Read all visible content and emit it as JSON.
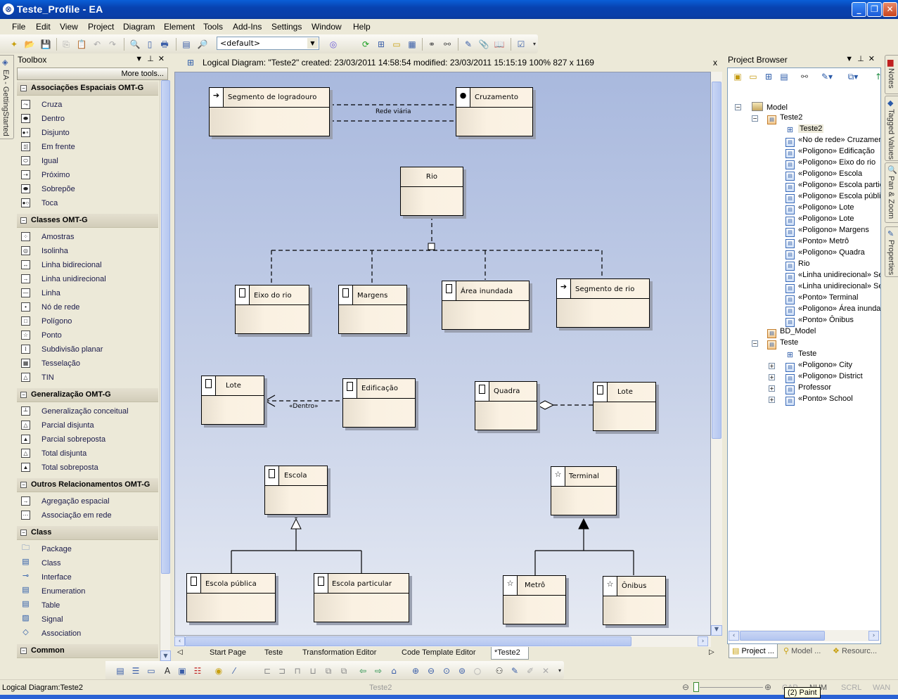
{
  "window": {
    "title": "Teste_Profile - EA"
  },
  "menu": [
    "File",
    "Edit",
    "View",
    "Project",
    "Diagram",
    "Element",
    "Tools",
    "Add-Ins",
    "Settings",
    "Window",
    "Help"
  ],
  "toolbar": {
    "perspective_value": "<default>"
  },
  "left_side_tab": "EA - GettingStarted",
  "toolbox": {
    "title": "Toolbox",
    "more_tools": "More tools...",
    "groups": [
      {
        "name": "Associações Espaciais OMT-G",
        "items": [
          {
            "label": "Cruza",
            "icon": "cross-relation-icon"
          },
          {
            "label": "Dentro",
            "icon": "inside-relation-icon"
          },
          {
            "label": "Disjunto",
            "icon": "disjoint-relation-icon"
          },
          {
            "label": "Em frente",
            "icon": "in-front-relation-icon"
          },
          {
            "label": "Igual",
            "icon": "equal-relation-icon"
          },
          {
            "label": "Próximo",
            "icon": "near-relation-icon"
          },
          {
            "label": "Sobrepõe",
            "icon": "overlap-relation-icon"
          },
          {
            "label": "Toca",
            "icon": "touch-relation-icon"
          }
        ]
      },
      {
        "name": "Classes OMT-G",
        "items": [
          {
            "label": "Amostras",
            "icon": "samples-icon"
          },
          {
            "label": "Isolinha",
            "icon": "isoline-icon"
          },
          {
            "label": "Linha bidirecional",
            "icon": "bidirectional-line-icon"
          },
          {
            "label": "Linha unidirecional",
            "icon": "unidirectional-line-icon"
          },
          {
            "label": "Linha",
            "icon": "line-icon"
          },
          {
            "label": "Nó de rede",
            "icon": "network-node-icon"
          },
          {
            "label": "Polígono",
            "icon": "polygon-icon"
          },
          {
            "label": "Ponto",
            "icon": "point-star-icon"
          },
          {
            "label": "Subdivisão planar",
            "icon": "planar-subdivision-icon"
          },
          {
            "label": "Tesselação",
            "icon": "tessellation-icon"
          },
          {
            "label": "TIN",
            "icon": "tin-icon"
          }
        ]
      },
      {
        "name": "Generalização OMT-G",
        "items": [
          {
            "label": "Generalização conceitual",
            "icon": "conceptual-generalization-icon"
          },
          {
            "label": "Parcial disjunta",
            "icon": "partial-disjoint-icon"
          },
          {
            "label": "Parcial sobreposta",
            "icon": "partial-overlapping-icon"
          },
          {
            "label": "Total disjunta",
            "icon": "total-disjoint-icon"
          },
          {
            "label": "Total sobreposta",
            "icon": "total-overlapping-icon"
          }
        ]
      },
      {
        "name": "Outros Relacionamentos OMT-G",
        "items": [
          {
            "label": "Agregação espacial",
            "icon": "spatial-aggregation-icon"
          },
          {
            "label": "Associação em rede",
            "icon": "network-association-icon"
          }
        ]
      },
      {
        "name": "Class",
        "items": [
          {
            "label": "Package",
            "icon": "package-icon"
          },
          {
            "label": "Class",
            "icon": "class-icon"
          },
          {
            "label": "Interface",
            "icon": "interface-icon"
          },
          {
            "label": "Enumeration",
            "icon": "enumeration-icon"
          },
          {
            "label": "Table",
            "icon": "table-icon"
          },
          {
            "label": "Signal",
            "icon": "signal-icon"
          },
          {
            "label": "Association",
            "icon": "association-icon"
          }
        ]
      },
      {
        "name": "Common",
        "items": []
      }
    ]
  },
  "diagram": {
    "header": "Logical Diagram: \"Teste2\"   created: 23/03/2011 14:58:54  modified: 23/03/2011 15:15:19   100%   827 x 1169",
    "classes": {
      "segmento_logradouro": "Segmento de logradouro",
      "cruzamento": "Cruzamento",
      "rio": "Rio",
      "eixo_rio": "Eixo do rio",
      "margens": "Margens",
      "area_inundada": "Área inundada",
      "segmento_rio": "Segmento de rio",
      "lote1": "Lote",
      "edificacao": "Edificação",
      "quadra": "Quadra",
      "lote2": "Lote",
      "escola": "Escola",
      "escola_publica": "Escola pública",
      "escola_particular": "Escola particular",
      "terminal": "Terminal",
      "metro": "Metrô",
      "onibus": "Ônibus"
    },
    "labels": {
      "rede_viaria": "Rede viária",
      "dentro": "«Dentro»"
    }
  },
  "doc_tabs": [
    "Start Page",
    "Teste",
    "Transformation Editor",
    "Code Template Editor",
    "*Teste2"
  ],
  "active_doc_tab": "*Teste2",
  "project_browser": {
    "title": "Project Browser",
    "tree": [
      {
        "label": "Model",
        "level": 0,
        "type": "model",
        "expander": "-"
      },
      {
        "label": "Teste2",
        "level": 1,
        "type": "package",
        "expander": "-"
      },
      {
        "label": "Teste2",
        "level": 2,
        "type": "diagram",
        "selected": true
      },
      {
        "label": "«No de rede» Cruzamento",
        "level": 2,
        "type": "class"
      },
      {
        "label": "«Poligono» Edificação",
        "level": 2,
        "type": "class"
      },
      {
        "label": "«Poligono» Eixo do rio",
        "level": 2,
        "type": "class"
      },
      {
        "label": "«Poligono» Escola",
        "level": 2,
        "type": "class"
      },
      {
        "label": "«Poligono» Escola particular",
        "level": 2,
        "type": "class"
      },
      {
        "label": "«Poligono» Escola pública",
        "level": 2,
        "type": "class"
      },
      {
        "label": "«Poligono» Lote",
        "level": 2,
        "type": "class"
      },
      {
        "label": "«Poligono» Lote",
        "level": 2,
        "type": "class"
      },
      {
        "label": "«Poligono» Margens",
        "level": 2,
        "type": "class"
      },
      {
        "label": "«Ponto» Metrô",
        "level": 2,
        "type": "class"
      },
      {
        "label": "«Poligono» Quadra",
        "level": 2,
        "type": "class"
      },
      {
        "label": "Rio",
        "level": 2,
        "type": "class"
      },
      {
        "label": "«Linha unidirecional» Segmento de logradouro",
        "level": 2,
        "type": "class"
      },
      {
        "label": "«Linha unidirecional» Segmento de rio",
        "level": 2,
        "type": "class"
      },
      {
        "label": "«Ponto» Terminal",
        "level": 2,
        "type": "class"
      },
      {
        "label": "«Poligono» Área inundada",
        "level": 2,
        "type": "class"
      },
      {
        "label": "«Ponto» Ônibus",
        "level": 2,
        "type": "class"
      },
      {
        "label": "BD_Model",
        "level": 1,
        "type": "package"
      },
      {
        "label": "Teste",
        "level": 1,
        "type": "package",
        "expander": "-"
      },
      {
        "label": "Teste",
        "level": 2,
        "type": "diagram"
      },
      {
        "label": "«Poligono» City",
        "level": 2,
        "type": "class",
        "expander": "+"
      },
      {
        "label": "«Poligono» District",
        "level": 2,
        "type": "class",
        "expander": "+"
      },
      {
        "label": "Professor",
        "level": 2,
        "type": "class",
        "expander": "+"
      },
      {
        "label": "«Ponto» School",
        "level": 2,
        "type": "class",
        "expander": "+"
      }
    ],
    "tabs": [
      "Project ...",
      "Model ...",
      "Resourc..."
    ]
  },
  "right_tabs": [
    "Notes",
    "Tagged Values",
    "Pan & Zoom",
    "Properties"
  ],
  "status": {
    "left": "Logical Diagram:Teste2",
    "center": "Teste2",
    "indicators": [
      "CAP",
      "NUM",
      "SCRL",
      "WAN"
    ]
  },
  "tooltip": "(2) Paint"
}
